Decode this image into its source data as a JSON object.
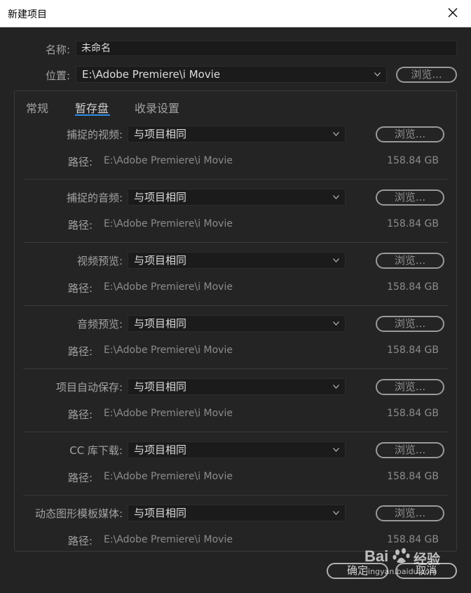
{
  "window": {
    "title": "新建项目"
  },
  "top": {
    "name_label": "名称:",
    "name_value": "未命名",
    "location_label": "位置:",
    "location_value": "E:\\Adobe Premiere\\i Movie",
    "browse_label": "浏览..."
  },
  "tabs": [
    {
      "label": "常规",
      "active": false
    },
    {
      "label": "暂存盘",
      "active": true
    },
    {
      "label": "收录设置",
      "active": false
    }
  ],
  "scratch_disks": [
    {
      "label": "捕捉的视频:",
      "value": "与项目相同",
      "browse": "浏览...",
      "path_label": "路径:",
      "path": "E:\\Adobe Premiere\\i Movie",
      "size": "158.84 GB"
    },
    {
      "label": "捕捉的音频:",
      "value": "与项目相同",
      "browse": "浏览...",
      "path_label": "路径:",
      "path": "E:\\Adobe Premiere\\i Movie",
      "size": "158.84 GB"
    },
    {
      "label": "视频预览:",
      "value": "与项目相同",
      "browse": "浏览...",
      "path_label": "路径:",
      "path": "E:\\Adobe Premiere\\i Movie",
      "size": "158.84 GB"
    },
    {
      "label": "音频预览:",
      "value": "与项目相同",
      "browse": "浏览...",
      "path_label": "路径:",
      "path": "E:\\Adobe Premiere\\i Movie",
      "size": "158.84 GB"
    },
    {
      "label": "项目自动保存:",
      "value": "与项目相同",
      "browse": "浏览...",
      "path_label": "路径:",
      "path": "E:\\Adobe Premiere\\i Movie",
      "size": "158.84 GB"
    },
    {
      "label": "CC 库下载:",
      "value": "与项目相同",
      "browse": "浏览...",
      "path_label": "路径:",
      "path": "E:\\Adobe Premiere\\i Movie",
      "size": "158.84 GB"
    },
    {
      "label": "动态图形模板媒体:",
      "value": "与项目相同",
      "browse": "浏览...",
      "path_label": "路径:",
      "path": "E:\\Adobe Premiere\\i Movie",
      "size": "158.84 GB"
    }
  ],
  "footer": {
    "ok_label": "确定",
    "cancel_label": "取消"
  },
  "watermark": {
    "brand": "Bai",
    "brand_suffix": "经验",
    "url": "jingyan.baidu.com"
  }
}
